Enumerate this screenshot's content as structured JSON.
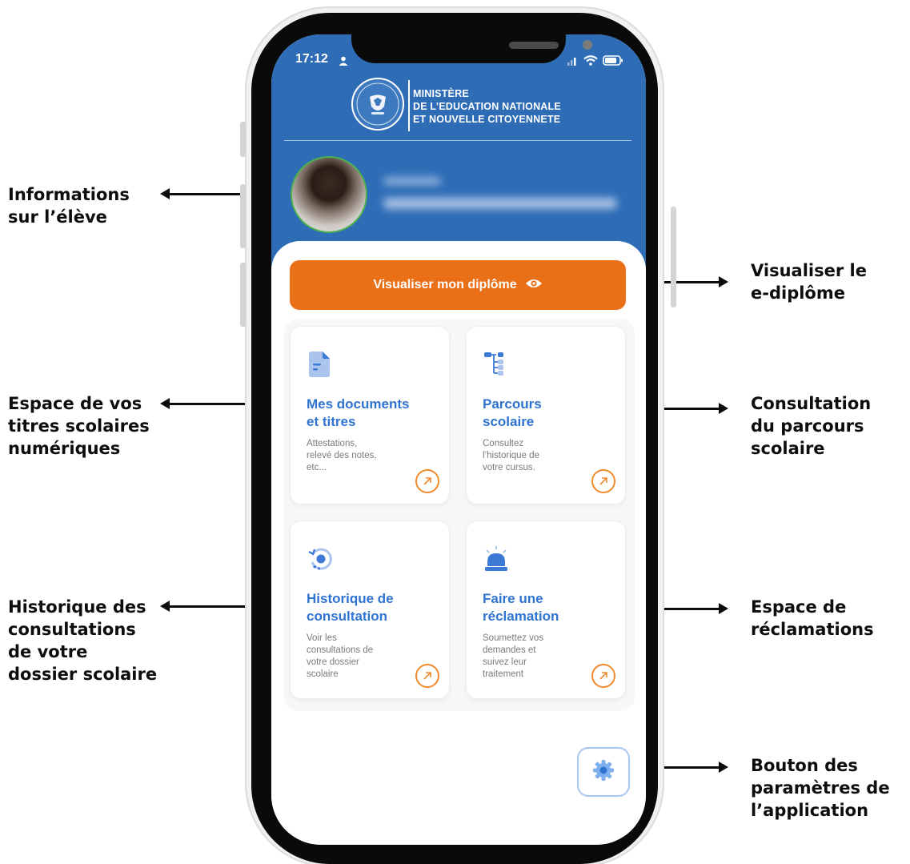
{
  "annotations": {
    "student_info": "Informations\nsur l’élève",
    "view_diploma": "Visualiser le\ne-diplôme",
    "documents_space": "Espace de vos\ntitres scolaires\nnumériques",
    "school_path": "Consultation\ndu parcours\nscolaire",
    "consultation_history": "Historique des\nconsultations\nde votre\ndossier scolaire",
    "complaints_space": "Espace de\nréclamations",
    "settings_button": "Bouton des\nparamètres de\nl’application"
  },
  "status_bar": {
    "time": "17:12"
  },
  "header": {
    "ministry_line1": "MINISTÈRE",
    "ministry_line2": "DE L’EDUCATION NATIONALE",
    "ministry_line3": "ET NOUVELLE CITOYENNETE"
  },
  "actions": {
    "view_diploma_label": "Visualiser mon diplôme"
  },
  "tiles": [
    {
      "title": "Mes documents\net titres",
      "description": "Attestations,\nrelevé des notes,\netc..."
    },
    {
      "title": "Parcours\nscolaire",
      "description": "Consultez\nl’historique de\nvotre cursus."
    },
    {
      "title": "Historique de\nconsultation",
      "description": "Voir les\nconsultations de\nvotre dossier\nscolaire"
    },
    {
      "title": "Faire une\nréclamation",
      "description": "Soumettez vos\ndemandes et\nsuivez leur\ntraitement"
    }
  ],
  "colors": {
    "brand_blue": "#2e6db6",
    "accent_orange": "#ea7018",
    "tile_title_blue": "#2f73d1",
    "avatar_ring": "#4db24d"
  },
  "icons": {
    "document": "document-icon",
    "path": "tree-path-icon",
    "history": "history-icon",
    "complaint": "alarm-icon",
    "settings": "gear-icon",
    "eye": "eye-icon",
    "arrow": "arrow-up-right-icon"
  }
}
